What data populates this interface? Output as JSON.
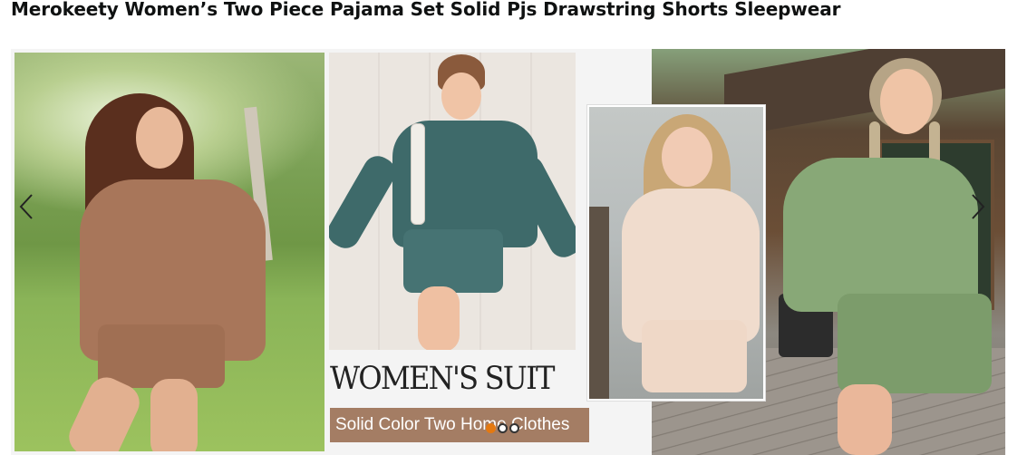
{
  "product": {
    "title": "Merokeety Women’s Two Piece Pajama Set Solid Pjs Drawstring Shorts Sleepwear"
  },
  "gallery": {
    "suit_heading": "WOMEN'S SUIT",
    "badge_text": "Solid Color Two Home Clothes",
    "badge_color": "#a47d64",
    "slide_count": 3,
    "active_slide": 1,
    "dot_active_color": "#e47911"
  },
  "navigation": {
    "prev_icon": "chevron-left-icon",
    "next_icon": "chevron-right-icon"
  }
}
